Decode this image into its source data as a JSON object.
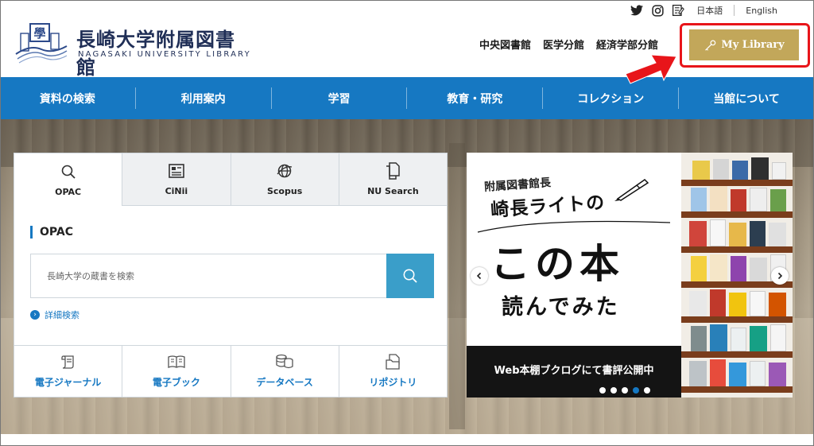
{
  "logo": {
    "jp": "長崎大学附属図書館",
    "en": "NAGASAKI UNIVERSITY LIBRARY"
  },
  "utility": {
    "lang_jp": "日本語",
    "lang_en": "English"
  },
  "branches": [
    "中央図書館",
    "医学分館",
    "経済学部分館"
  ],
  "mylibrary": {
    "label": "My Library"
  },
  "nav": [
    "資料の検索",
    "利用案内",
    "学習",
    "教育・研究",
    "コレクション",
    "当館について"
  ],
  "search": {
    "tabs": [
      "OPAC",
      "CiNii",
      "Scopus",
      "NU Search"
    ],
    "section_title": "OPAC",
    "placeholder": "長崎大学の蔵書を検索",
    "advanced": "詳細検索"
  },
  "quicklinks": [
    "電子ジャーナル",
    "電子ブック",
    "データベース",
    "リポジトリ"
  ],
  "banner": {
    "subtitle": "附属図書館長",
    "name": "崎長ライトの",
    "headline": "この本",
    "headline2": "読んでみた",
    "footer": "Web本棚ブクログにて書評公開中",
    "slides": 5,
    "active_slide": 4
  },
  "colors": {
    "nav_bg": "#1678c2",
    "mylibrary_bg": "#c2a75a",
    "highlight": "#e8151a",
    "search_btn": "#3a9ec9"
  }
}
